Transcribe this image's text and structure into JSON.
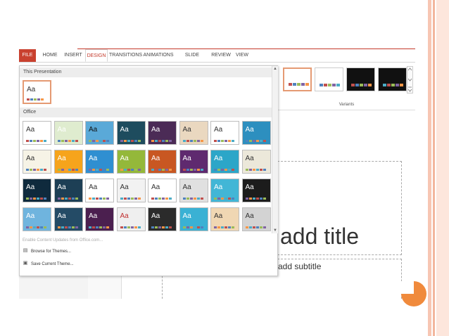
{
  "ribbon": {
    "tabs": [
      {
        "label": "FILE"
      },
      {
        "label": "HOME"
      },
      {
        "label": "INSERT"
      },
      {
        "label": "DESIGN"
      },
      {
        "label": "TRANSITIONS"
      },
      {
        "label": "ANIMATIONS"
      },
      {
        "label": "SLIDE SHOW"
      },
      {
        "label": "REVIEW"
      },
      {
        "label": "VIEW"
      }
    ]
  },
  "dropdown": {
    "section_this": "This Presentation",
    "section_office": "Office",
    "theme_aa": "Aa",
    "menu": {
      "enable_updates": "Enable Content Updates from Office.com...",
      "browse": "Browse for Themes...",
      "save": "Save Current Theme..."
    }
  },
  "variants": {
    "label": "Variants"
  },
  "slide": {
    "title_placeholder": "add title",
    "subtitle_placeholder": "add subtitle"
  },
  "colors": {
    "accent": "#c4392b",
    "orange": "#f08a3c",
    "stripe_palette": [
      "#c0504d",
      "#4f81bd",
      "#9bbb59",
      "#8064a2",
      "#f79646",
      "#4bacc6"
    ]
  }
}
